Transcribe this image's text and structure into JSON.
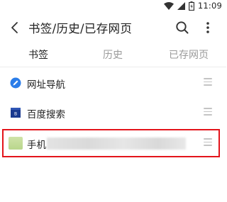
{
  "status_bar": {
    "time": "11:09",
    "icons": [
      "wifi-icon",
      "signal-icon",
      "battery-icon"
    ]
  },
  "header": {
    "title": "书签/历史/已存网页",
    "back_icon": "back-arrow-icon",
    "search_icon": "search-icon",
    "more_icon": "more-vertical-icon"
  },
  "tabs": [
    {
      "label": "书签",
      "active": true
    },
    {
      "label": "历史",
      "active": false
    },
    {
      "label": "已存网页",
      "active": false
    }
  ],
  "bookmarks": [
    {
      "label": "网址导航",
      "icon": "compass-pen-icon",
      "icon_color": "#2b7de9"
    },
    {
      "label": "百度搜索",
      "icon": "baidu-square-icon",
      "icon_color": "#1a3a8f"
    },
    {
      "label": "手机",
      "icon": "thumbnail-icon",
      "icon_color": "#bcd88e",
      "redacted": true,
      "highlighted": true
    }
  ],
  "highlight_color": "#e3141b"
}
